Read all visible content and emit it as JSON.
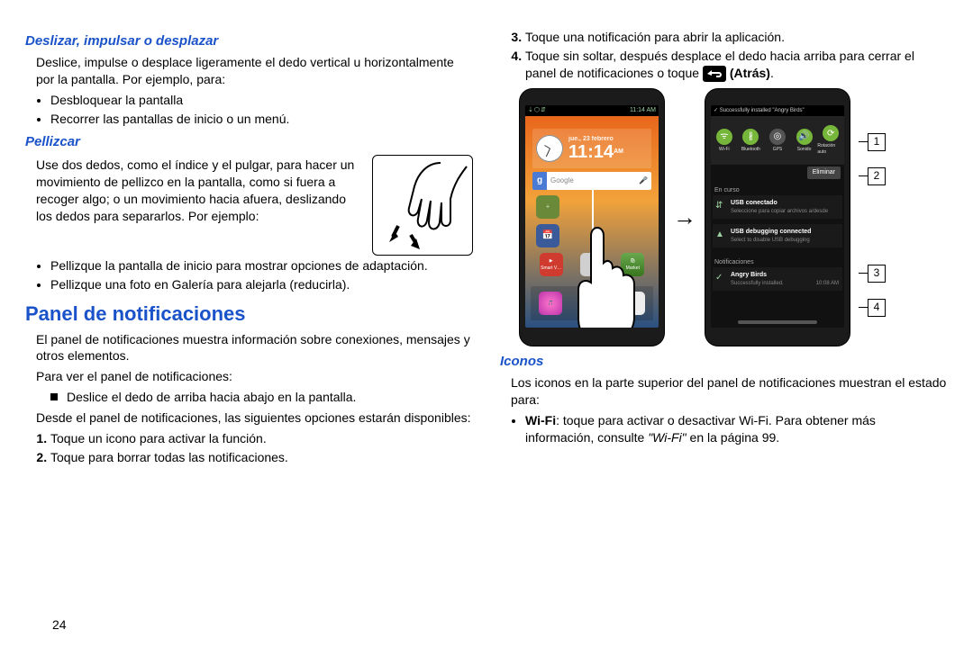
{
  "left": {
    "h1": "Deslizar, impulsar o desplazar",
    "p1": "Deslice, impulse o desplace ligeramente el dedo vertical u horizontalmente por la pantalla. Por ejemplo, para:",
    "b1": "Desbloquear la pantalla",
    "b2": "Recorrer las pantallas de inicio o un menú.",
    "h2": "Pellizcar",
    "p2": "Use dos dedos, como el índice y el pulgar, para hacer un movimiento de pellizco en la pantalla, como si fuera a recoger algo; o un movimiento hacia afuera, deslizando los dedos para separarlos. Por ejemplo:",
    "b3": "Pellizque la pantalla de inicio para mostrar opciones de adaptación.",
    "b4": "Pellizque una foto en Galería para alejarla (reducirla).",
    "h3": "Panel de notificaciones",
    "p3": "El panel de notificaciones muestra información sobre conexiones, mensajes y otros elementos.",
    "p4": "Para ver el panel de notificaciones:",
    "sq1": "Deslice el dedo de arriba hacia abajo en la pantalla.",
    "p5": "Desde el panel de notificaciones, las siguientes opciones estarán disponibles:",
    "n1": "Toque un icono para activar la función.",
    "n2": "Toque para borrar todas las notificaciones."
  },
  "right": {
    "n3": "Toque una notificación para abrir la aplicación.",
    "n4a": "Toque sin soltar, después desplace el dedo hacia arriba para cerrar el panel de notificaciones o toque ",
    "n4b": "(Atrás)",
    "h4": "Iconos",
    "p6": "Los iconos en la parte superior del panel de notificaciones muestran el estado para:",
    "b5a": "Wi-Fi",
    "b5b": ": toque para activar o desactivar Wi-Fi. Para obtener más información, consulte ",
    "b5c": "\"Wi-Fi\"",
    "b5d": " en la página 99."
  },
  "phone1": {
    "status_time": "11:14 AM",
    "date": "jue., 23 febrero",
    "time": "11:14",
    "ampm": "AM",
    "search": "Google",
    "cal_lbl": "Cal",
    "smartv": "Smart V…",
    "gmail": "…",
    "market": "Market",
    "apps": "Apps"
  },
  "phone2": {
    "nbar_msg": "Successfully installed \"Angry Birds\"",
    "t1": "Wi-Fi",
    "t2": "Bluetooth",
    "t3": "GPS",
    "t4": "Sonido",
    "t5": "Rotación auto",
    "clear": "Eliminar",
    "encurso": "En curso",
    "u1_title": "USB conectado",
    "u1_sub": "Seleccione para copiar archivos a/desde",
    "u2_title": "USB debugging connected",
    "u2_sub": "Select to disable USB debugging",
    "notifs": "Notificaciones",
    "a1_title": "Angry Birds",
    "a1_sub": "Successfully installed.",
    "a1_time": "10:08 AM"
  },
  "callouts": {
    "c1": "1",
    "c2": "2",
    "c3": "3",
    "c4": "4"
  },
  "page_num": "24"
}
